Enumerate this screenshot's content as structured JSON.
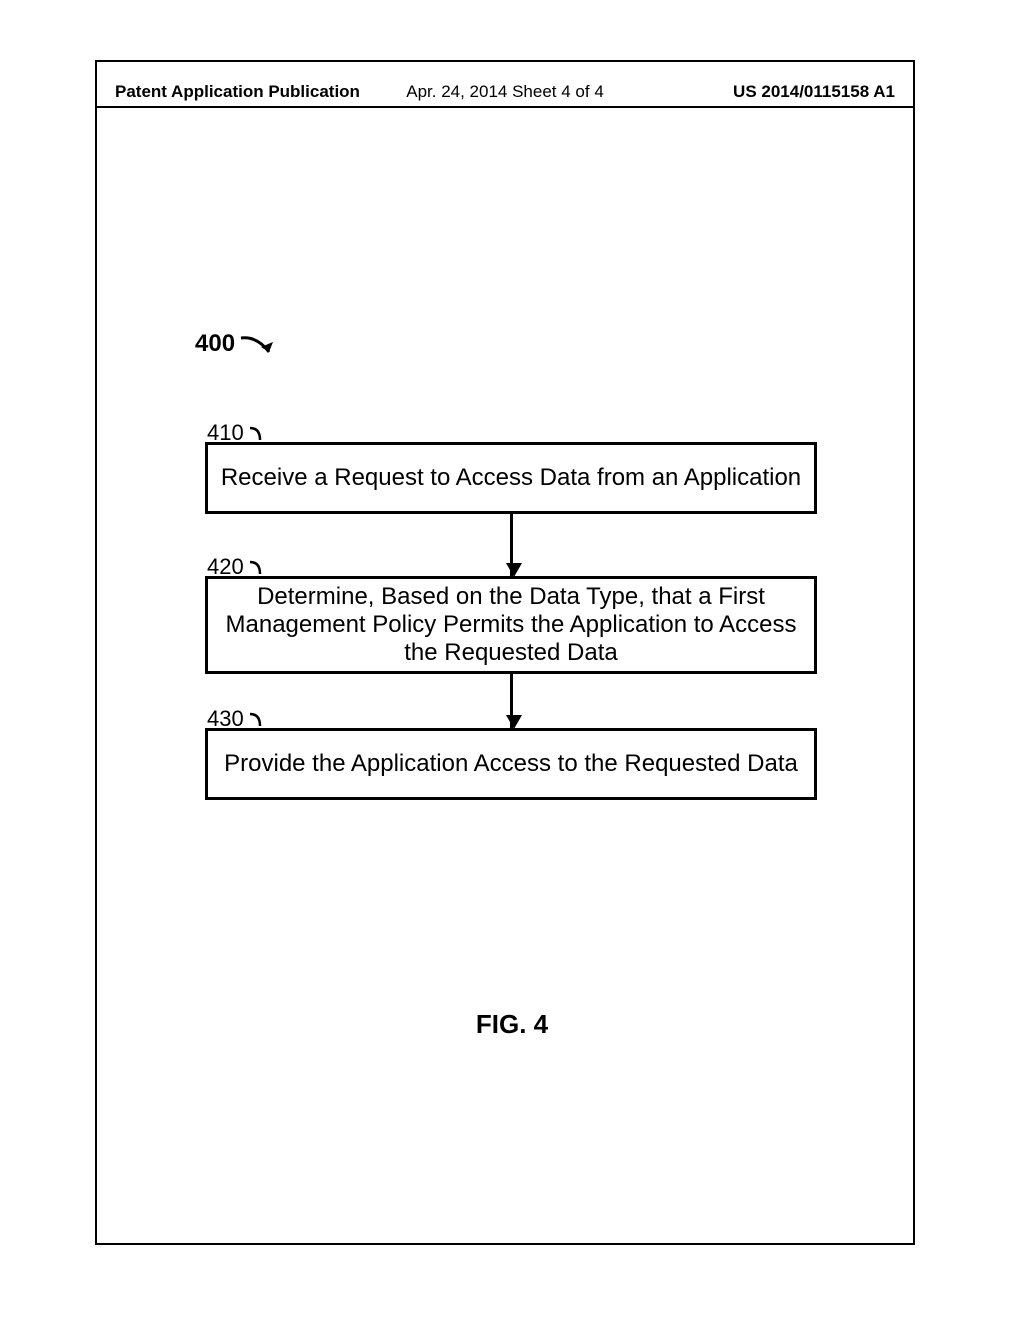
{
  "header": {
    "left": "Patent Application Publication",
    "center": "Apr. 24, 2014  Sheet 4 of 4",
    "right": "US 2014/0115158 A1"
  },
  "flowchart": {
    "ref": "400",
    "steps": [
      {
        "id": "410",
        "text": "Receive a Request to Access Data from an Application"
      },
      {
        "id": "420",
        "text": "Determine, Based on the Data Type, that a First Management Policy Permits the Application to Access the Requested Data"
      },
      {
        "id": "430",
        "text": "Provide the Application Access to the Requested Data"
      }
    ]
  },
  "figure_caption": "FIG. 4"
}
